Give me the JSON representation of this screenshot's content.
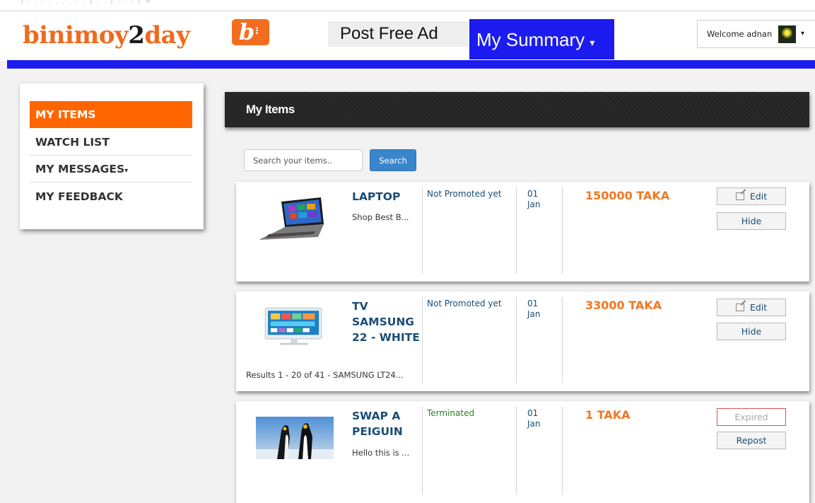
{
  "header": {
    "logo_part1": "binimoy",
    "logo_part2": "2",
    "logo_part3": "day",
    "badge_glyph": "b",
    "post_ad": "Post Free Ad",
    "my_summary": "My Summary",
    "welcome": "Welcome adnan",
    "accent_orange": "#f36d21",
    "nav_blue": "#1c1cf0"
  },
  "sidebar": {
    "items": [
      {
        "label": "MY ITEMS",
        "active": true
      },
      {
        "label": "WATCH LIST"
      },
      {
        "label": "MY MESSAGES"
      },
      {
        "label": "MY FEEDBACK"
      }
    ]
  },
  "main": {
    "title": "My Items",
    "search_placeholder": "Search your items..",
    "search_button": "Search"
  },
  "items": [
    {
      "title": "LAPTOP",
      "description": "Shop Best B...",
      "status": "Not Promoted yet",
      "date": "01 Jan",
      "price": "150000 TAKA",
      "button1": "Edit",
      "button2": "Hide",
      "image": "laptop-image"
    },
    {
      "title": "TV SAMSUNG 22 - WHITE",
      "description": "Results 1 - 20 of 41 - SAMSUNG LT24...",
      "status": "Not Promoted yet",
      "date": "01 Jan",
      "price": "33000 TAKA",
      "button1": "Edit",
      "button2": "Hide",
      "image": "tv-image"
    },
    {
      "title": "SWAP A PEIGUIN",
      "description": "Hello this is ...",
      "status": "Terminated",
      "date": "01 Jan",
      "price": "1 TAKA",
      "button1": "Expired",
      "button2": "Repost",
      "image": "penguin-image"
    }
  ]
}
